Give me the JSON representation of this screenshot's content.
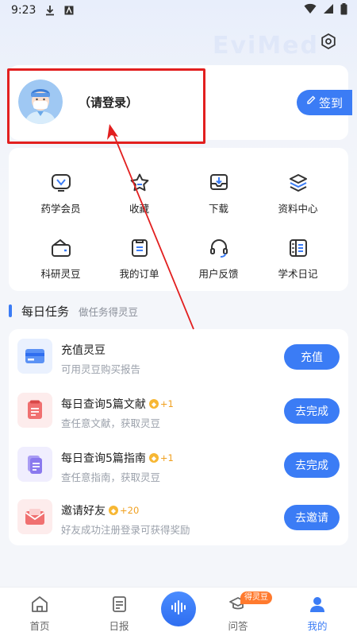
{
  "status_bar": {
    "time": "9:23",
    "left_icons": [
      "download-icon",
      "a-badge-icon"
    ],
    "right_icons": [
      "wifi-icon",
      "signal-icon",
      "battery-icon"
    ]
  },
  "header": {
    "watermark": "EviMed",
    "settings_icon": "gear-icon"
  },
  "profile": {
    "login_text": "（请登录）",
    "signin_label": "签到",
    "signin_icon": "pencil-icon"
  },
  "menu": {
    "items": [
      {
        "label": "药学会员",
        "icon": "vip-icon"
      },
      {
        "label": "收藏",
        "icon": "star-icon"
      },
      {
        "label": "下载",
        "icon": "download-box-icon"
      },
      {
        "label": "资料中心",
        "icon": "layers-icon"
      },
      {
        "label": "科研灵豆",
        "icon": "wallet-icon"
      },
      {
        "label": "我的订单",
        "icon": "order-icon"
      },
      {
        "label": "用户反馈",
        "icon": "headset-icon"
      },
      {
        "label": "学术日记",
        "icon": "diary-icon"
      }
    ]
  },
  "tasks": {
    "title": "每日任务",
    "subtitle": "做任务得灵豆",
    "items": [
      {
        "title": "充值灵豆",
        "reward": "",
        "desc": "可用灵豆购买报告",
        "button": "充值",
        "icon": "card-icon"
      },
      {
        "title": "每日查询5篇文献",
        "reward": "+1",
        "desc": "查任意文献，获取灵豆",
        "button": "去完成",
        "icon": "document-icon"
      },
      {
        "title": "每日查询5篇指南",
        "reward": "+1",
        "desc": "查任意指南，获取灵豆",
        "button": "去完成",
        "icon": "guide-icon"
      },
      {
        "title": "邀请好友",
        "reward": "+20",
        "desc": "好友成功注册登录可获得奖励",
        "button": "去邀请",
        "icon": "envelope-icon"
      }
    ]
  },
  "tab_bar": {
    "tabs": [
      {
        "label": "首页",
        "icon": "home-icon"
      },
      {
        "label": "日报",
        "icon": "report-icon"
      },
      {
        "label": "",
        "icon": "voice-icon"
      },
      {
        "label": "问答",
        "icon": "graduation-cap-icon"
      },
      {
        "label": "我的",
        "icon": "user-icon"
      }
    ],
    "badge": "得灵豆",
    "active_index": 4
  },
  "colors": {
    "accent": "#3b7cf5",
    "highlight": "#e21f1f",
    "reward": "#f0a020"
  }
}
